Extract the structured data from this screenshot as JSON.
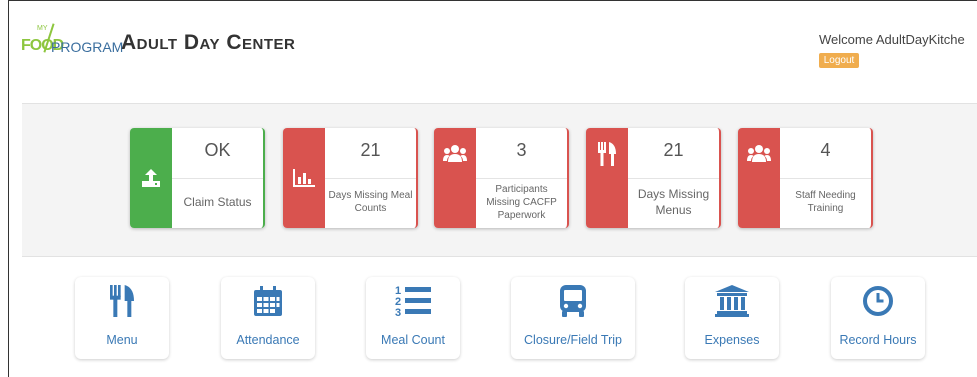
{
  "header": {
    "logo": {
      "my": "MY",
      "food": "FOOD",
      "program": "PROGRAM"
    },
    "title": "Adult Day Center",
    "welcome": "Welcome AdultDayKitche",
    "logout_label": "Logout"
  },
  "colors": {
    "accent": "#3a79b5",
    "ok": "#4cae4c",
    "alert": "#d9534f",
    "logout": "#f0ad4e"
  },
  "status_cards": [
    {
      "icon": "upload-icon",
      "value": "OK",
      "label": "Claim Status",
      "state": "ok"
    },
    {
      "icon": "bar-chart-icon",
      "value": "21",
      "label": "Days Missing Meal Counts",
      "state": "alert"
    },
    {
      "icon": "users-icon",
      "value": "3",
      "label": "Participants Missing CACFP Paperwork",
      "state": "alert"
    },
    {
      "icon": "utensils-icon",
      "value": "21",
      "label": "Days Missing Menus",
      "state": "alert"
    },
    {
      "icon": "users-icon",
      "value": "4",
      "label": "Staff Needing Training",
      "state": "alert"
    }
  ],
  "quick_links": [
    {
      "icon": "utensils-icon",
      "label": "Menu"
    },
    {
      "icon": "calendar-icon",
      "label": "Attendance"
    },
    {
      "icon": "numbered-list-icon",
      "label": "Meal Count"
    },
    {
      "icon": "bus-icon",
      "label": "Closure/Field Trip"
    },
    {
      "icon": "bank-icon",
      "label": "Expenses"
    },
    {
      "icon": "clock-icon",
      "label": "Record Hours"
    }
  ]
}
